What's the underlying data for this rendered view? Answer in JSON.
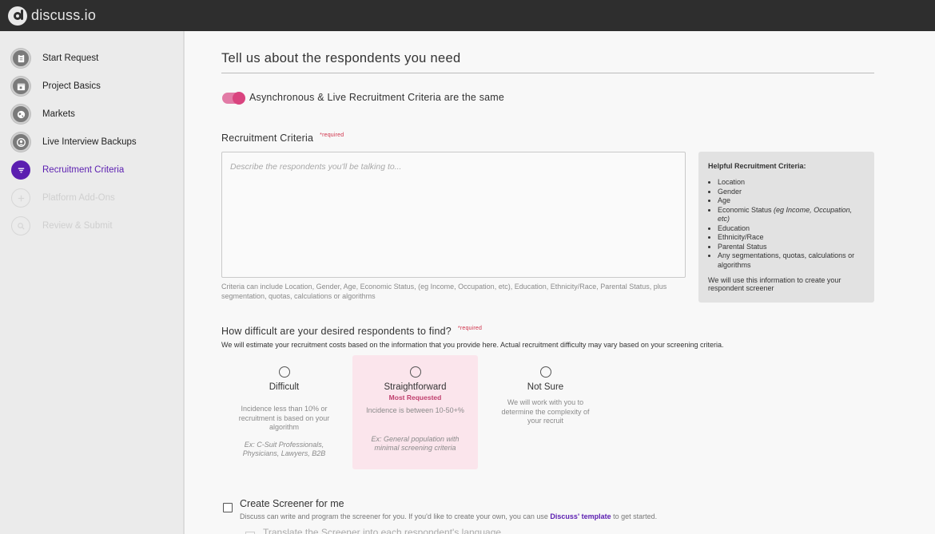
{
  "app": {
    "name": "discuss.io"
  },
  "sidebar": {
    "items": [
      {
        "label": "Start Request",
        "icon": "clipboard-icon",
        "state": "done"
      },
      {
        "label": "Project Basics",
        "icon": "calendar-icon",
        "state": "done"
      },
      {
        "label": "Markets",
        "icon": "globe-icon",
        "state": "done"
      },
      {
        "label": "Live Interview Backups",
        "icon": "user-icon",
        "state": "done"
      },
      {
        "label": "Recruitment Criteria",
        "icon": "filter-icon",
        "state": "active"
      },
      {
        "label": "Platform Add-Ons",
        "icon": "plus-icon",
        "state": "disabled"
      },
      {
        "label": "Review & Submit",
        "icon": "search-icon",
        "state": "disabled"
      }
    ]
  },
  "main": {
    "title": "Tell us about the respondents you need",
    "toggle": {
      "label": "Asynchronous & Live Recruitment Criteria are the same",
      "on": true
    },
    "criteria": {
      "label": "Recruitment Criteria",
      "required": "*required",
      "placeholder": "Describe the respondents you'll be talking to...",
      "help": "Criteria can include Location, Gender, Age, Economic Status, (eg Income, Occupation, etc), Education, Ethnicity/Race, Parental Status, plus segmentation, quotas, calculations or algorithms"
    },
    "helpful": {
      "title": "Helpful Recruitment Criteria:",
      "items": [
        "Location",
        "Gender",
        "Age",
        "Economic Status",
        "Education",
        "Ethnicity/Race",
        "Parental Status",
        "Any segmentations, quotas, calculations or algorithms"
      ],
      "economic_note": "(eg Income, Occupation, etc)",
      "note": "We will use this information to create your respondent screener"
    },
    "difficulty": {
      "label": "How difficult are your desired respondents to find?",
      "required": "*required",
      "subtitle": "We will estimate your recruitment costs based on the information that you provide here. Actual recruitment difficulty may vary based on your screening criteria.",
      "options": [
        {
          "title": "Difficult",
          "badge": "",
          "desc": "Incidence less than 10% or recruitment is based on your algorithm",
          "example": "Ex: C-Suit Professionals, Physicians, Lawyers, B2B"
        },
        {
          "title": "Straightforward",
          "badge": "Most Requested",
          "desc": "Incidence is between 10-50+%",
          "example": "Ex: General population with minimal screening criteria"
        },
        {
          "title": "Not Sure",
          "badge": "",
          "desc": "We will work with you to determine the complexity of your recruit",
          "example": ""
        }
      ]
    },
    "screener": {
      "title": "Create Screener for me",
      "sub_before": "Discuss can write and program the screener for you. If you'd like to create your own, you can use",
      "link": "Discuss' template",
      "sub_after": "to get started.",
      "translate": "Translate the Screener into each respondent's language"
    }
  },
  "colors": {
    "accent": "#5b1eb0",
    "toggle": "#d9447f",
    "selected_card": "#fbe5ec",
    "required": "#d0324a"
  }
}
